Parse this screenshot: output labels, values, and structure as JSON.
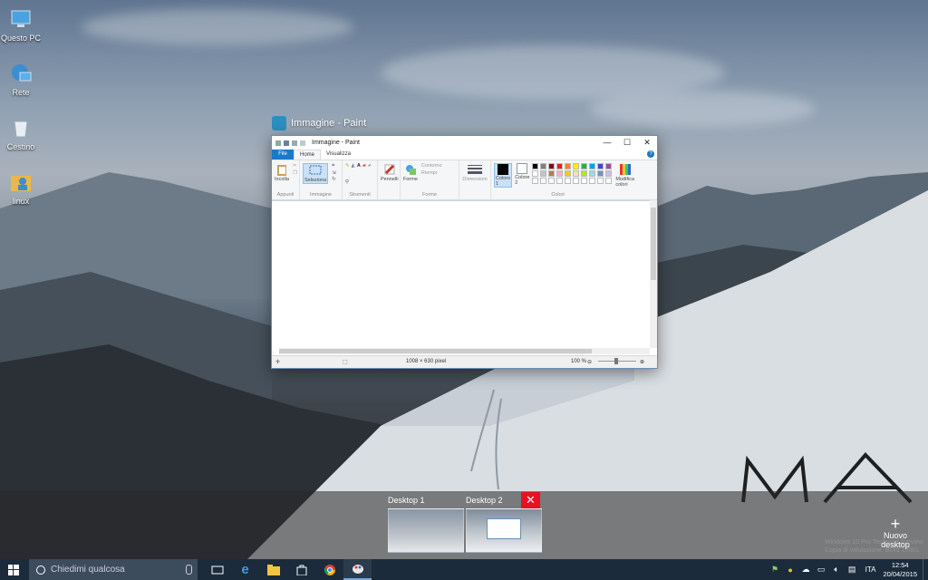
{
  "desktop": {
    "icons": [
      {
        "label": "Questo PC",
        "icon": "computer-icon"
      },
      {
        "label": "Rete",
        "icon": "network-icon"
      },
      {
        "label": "Cestino",
        "icon": "recycle-bin-icon"
      },
      {
        "label": "linux",
        "icon": "user-folder-icon"
      }
    ]
  },
  "paint": {
    "window_caption": "Immagine - Paint",
    "titlebar_text": "Immagine - Paint",
    "tabs": {
      "file": "File",
      "home": "Home",
      "view": "Visualizza"
    },
    "groups": {
      "clipboard": {
        "label": "Appunti",
        "paste": "Incolla"
      },
      "image": {
        "label": "Immagine",
        "select": "Seleziona"
      },
      "tools": {
        "label": "Strumenti"
      },
      "brushes": {
        "label": "Pennelli"
      },
      "shapes": {
        "label": "Forme",
        "shapes_btn": "Forme",
        "outline": "Contorno",
        "fill": "Riempi"
      },
      "size": {
        "label": "Dimensioni"
      },
      "colors": {
        "label": "Colori",
        "color1": "Colore 1",
        "color2": "Colore 2",
        "edit": "Modifica colori"
      }
    },
    "palette_row1": [
      "#000000",
      "#7f7f7f",
      "#880015",
      "#ed1c24",
      "#ff7f27",
      "#fff200",
      "#22b14c",
      "#00a2e8",
      "#3f48cc",
      "#a349a4"
    ],
    "palette_row2": [
      "#ffffff",
      "#c3c3c3",
      "#b97a57",
      "#ffaec9",
      "#ffc90e",
      "#efe4b0",
      "#b5e61d",
      "#99d9ea",
      "#7092be",
      "#c8bfe7"
    ],
    "status": {
      "dimensions": "1008 × 630 pixel",
      "zoom": "100 %"
    }
  },
  "taskview": {
    "desktop1": "Desktop 1",
    "desktop2": "Desktop 2",
    "new_desktop": "Nuovo desktop",
    "watermark_line1": "Windows 10 Pro Technical Preview",
    "watermark_line2": "Copia di valutazione. Build 10061"
  },
  "taskbar": {
    "search_placeholder": "Chiedimi qualcosa",
    "language": "ITA",
    "time": "12:54",
    "date": "20/04/2015"
  },
  "colors": {
    "taskbar": "#1b2b3c",
    "accent": "#1979ca",
    "close_red": "#e81123"
  }
}
